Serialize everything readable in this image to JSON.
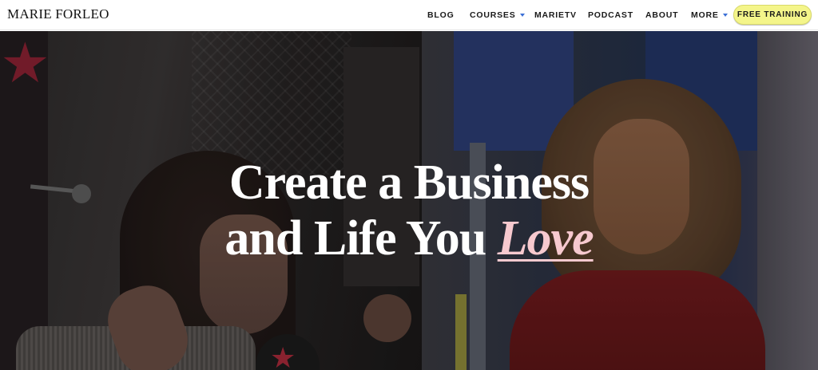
{
  "header": {
    "logo": "MARIE FORLEO",
    "nav": [
      {
        "label": "BLOG",
        "has_dropdown": false
      },
      {
        "label": "COURSES",
        "has_dropdown": true
      },
      {
        "label": "MARIETV",
        "has_dropdown": false
      },
      {
        "label": "PODCAST",
        "has_dropdown": false
      },
      {
        "label": "ABOUT",
        "has_dropdown": false
      },
      {
        "label": "MORE",
        "has_dropdown": true
      }
    ],
    "cta_label": "FREE TRAINING"
  },
  "hero": {
    "headline_line1": "Create a Business",
    "headline_line2_prefix": "and Life You ",
    "headline_emphasis": "Love"
  },
  "colors": {
    "cta_background": "#f4f58a",
    "caret": "#3b6fd6",
    "emphasis_text": "#f7c9cf"
  }
}
